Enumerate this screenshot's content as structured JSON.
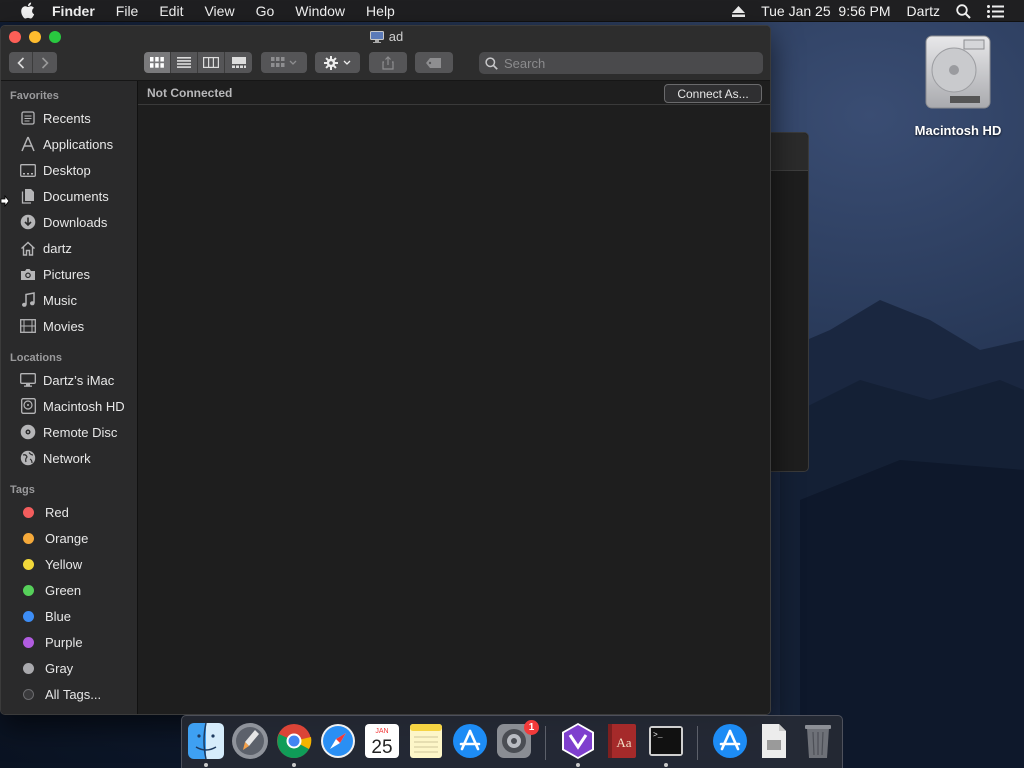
{
  "menubar": {
    "app_name": "Finder",
    "menus": [
      "File",
      "Edit",
      "View",
      "Go",
      "Window",
      "Help"
    ],
    "datetime": "Tue Jan 25  9:56 PM",
    "user": "Dartz"
  },
  "desktop": {
    "icons": [
      {
        "label": "Macintosh HD",
        "icon": "hard-drive-icon"
      }
    ]
  },
  "window": {
    "title": "ad",
    "search_placeholder": "Search",
    "status_text": "Not Connected",
    "connect_button": "Connect As..."
  },
  "sidebar": {
    "sections": [
      {
        "heading": "Favorites",
        "items": [
          {
            "label": "Recents",
            "icon": "clock-icon"
          },
          {
            "label": "Applications",
            "icon": "applications-icon"
          },
          {
            "label": "Desktop",
            "icon": "desktop-icon"
          },
          {
            "label": "Documents",
            "icon": "documents-icon"
          },
          {
            "label": "Downloads",
            "icon": "downloads-icon"
          },
          {
            "label": "dartz",
            "icon": "home-icon"
          },
          {
            "label": "Pictures",
            "icon": "camera-icon"
          },
          {
            "label": "Music",
            "icon": "music-note-icon"
          },
          {
            "label": "Movies",
            "icon": "film-icon"
          }
        ]
      },
      {
        "heading": "Locations",
        "items": [
          {
            "label": "Dartz’s iMac",
            "icon": "imac-icon"
          },
          {
            "label": "Macintosh HD",
            "icon": "disk-icon"
          },
          {
            "label": "Remote Disc",
            "icon": "disc-icon"
          },
          {
            "label": "Network",
            "icon": "globe-icon"
          }
        ]
      },
      {
        "heading": "Tags",
        "items": [
          {
            "label": "Red",
            "color": "#f35d5d"
          },
          {
            "label": "Orange",
            "color": "#f5a93a"
          },
          {
            "label": "Yellow",
            "color": "#f2d83a"
          },
          {
            "label": "Green",
            "color": "#56d05a"
          },
          {
            "label": "Blue",
            "color": "#3d8df5"
          },
          {
            "label": "Purple",
            "color": "#b15ce0"
          },
          {
            "label": "Gray",
            "color": "#a9a9ad"
          },
          {
            "label": "All Tags...",
            "color": "all-tags"
          }
        ]
      }
    ]
  },
  "dock": {
    "apps": [
      {
        "name": "Finder",
        "icon": "finder-icon",
        "running": true
      },
      {
        "name": "Launchpad",
        "icon": "launchpad-icon",
        "running": false
      },
      {
        "name": "Google Chrome",
        "icon": "chrome-icon",
        "running": true
      },
      {
        "name": "Safari",
        "icon": "safari-icon",
        "running": false
      },
      {
        "name": "Calendar",
        "icon": "calendar-icon",
        "running": false,
        "month": "JAN",
        "day": "25"
      },
      {
        "name": "Notes",
        "icon": "notes-icon",
        "running": false
      },
      {
        "name": "App Store",
        "icon": "app-store-icon",
        "running": false
      },
      {
        "name": "System Preferences",
        "icon": "system-preferences-icon",
        "running": false,
        "badge": "1"
      },
      {
        "name": "Visual Studio",
        "icon": "visual-studio-icon",
        "running": true
      },
      {
        "name": "Dictionary",
        "icon": "dictionary-icon",
        "running": false,
        "glyph": "Aa"
      },
      {
        "name": "Terminal",
        "icon": "terminal-icon",
        "running": true,
        "glyph": ">_"
      },
      {
        "name": "App Store Downloads",
        "icon": "app-store-folder-icon",
        "running": false
      },
      {
        "name": "Document",
        "icon": "document-icon",
        "running": false
      },
      {
        "name": "Trash",
        "icon": "trash-icon",
        "running": false
      }
    ]
  }
}
